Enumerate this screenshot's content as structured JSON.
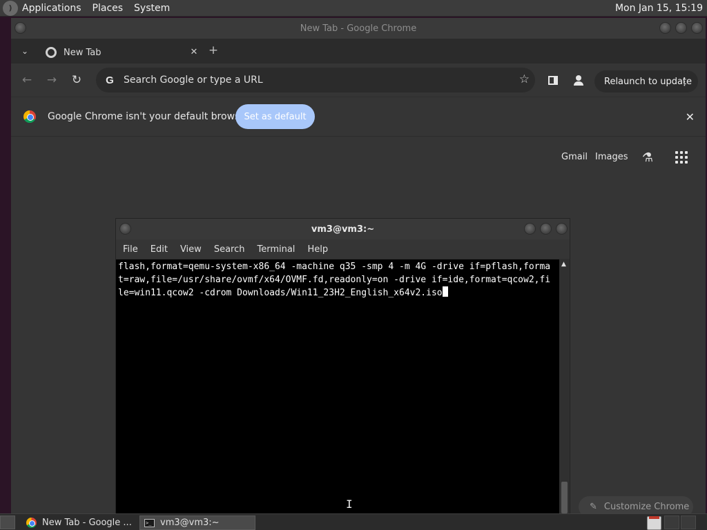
{
  "top_panel": {
    "menus": [
      "Applications",
      "Places",
      "System"
    ],
    "clock": "Mon Jan 15, 15:19"
  },
  "chrome": {
    "window_title": "New Tab - Google Chrome",
    "tab_label": "New Tab",
    "omnibox_placeholder": "Search Google or type a URL",
    "relaunch_label": "Relaunch to update",
    "infobar_text": "Google Chrome isn't your default browser",
    "set_default_label": "Set as default",
    "ntp_links": [
      "Gmail",
      "Images"
    ],
    "customize_label": "Customize Chrome"
  },
  "terminal": {
    "window_title": "vm3@vm3:~",
    "menus": [
      "File",
      "Edit",
      "View",
      "Search",
      "Terminal",
      "Help"
    ],
    "lines": [
      "flash,format=qemu-system-x86_64 -machine q35 -smp 4 -m 4G -drive if=pflash,forma",
      "t=raw,file=/usr/share/ovmf/x64/OVMF.fd,readonly=on -drive if=ide,format=qcow2,fi",
      "le=win11.qcow2 -cdrom Downloads/Win11_23H2_English_x64v2.iso"
    ]
  },
  "taskbar": {
    "items": [
      "New Tab - Google ...",
      "vm3@vm3:~"
    ]
  },
  "colors": {
    "set_default_bg": "#a8c7fa",
    "terminal_bg": "#000000",
    "chrome_bg": "#353535"
  }
}
